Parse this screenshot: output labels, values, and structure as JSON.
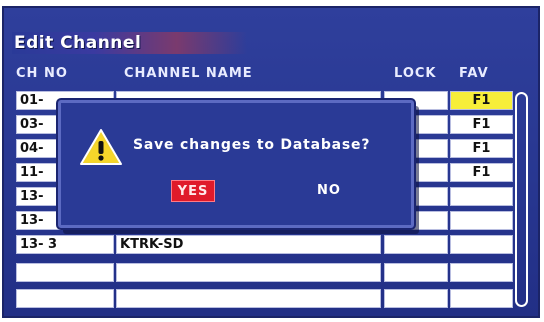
{
  "window": {
    "title": "Edit Channel"
  },
  "columns": {
    "ch_no": "CH NO",
    "channel_name": "CHANNEL NAME",
    "lock": "LOCK",
    "fav": "FAV"
  },
  "rows": [
    {
      "ch": "01-",
      "name": "",
      "lock": "",
      "fav": "F1",
      "fav_highlight": true
    },
    {
      "ch": "03-",
      "name": "",
      "lock": "",
      "fav": "F1"
    },
    {
      "ch": "04-",
      "name": "",
      "lock": "",
      "fav": "F1"
    },
    {
      "ch": "11-",
      "name": "",
      "lock": "",
      "fav": "F1"
    },
    {
      "ch": "13-",
      "name": "",
      "lock": "",
      "fav": ""
    },
    {
      "ch": "13-",
      "name": "",
      "lock": "",
      "fav": ""
    },
    {
      "ch": "13- 3",
      "name": "KTRK-SD",
      "lock": "",
      "fav": ""
    },
    {
      "ch": "",
      "name": "",
      "lock": "",
      "fav": ""
    },
    {
      "ch": "",
      "name": "",
      "lock": "",
      "fav": ""
    }
  ],
  "dialog": {
    "message": "Save changes to Database?",
    "yes_label": "YES",
    "no_label": "NO",
    "icon": "warning-icon"
  },
  "colors": {
    "background": "#2a3a96",
    "fav_highlight": "#f7ee3a",
    "yes_button": "#e01a2a"
  }
}
